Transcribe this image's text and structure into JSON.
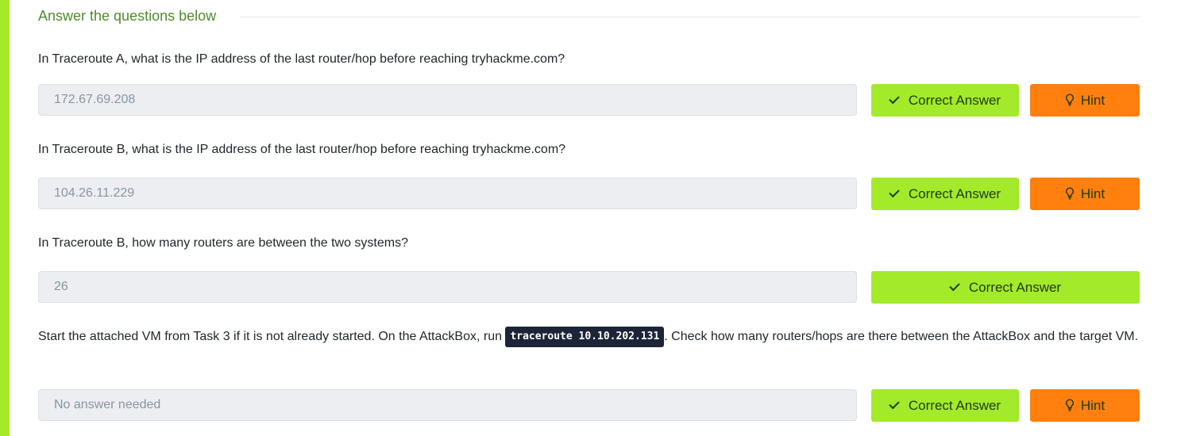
{
  "section": {
    "title": "Answer the questions below"
  },
  "questions": [
    {
      "text": "In Traceroute A, what is the IP address of the last router/hop before reaching tryhackme.com?",
      "answer": "172.67.69.208",
      "correct_label": "Correct Answer",
      "hint_label": "Hint"
    },
    {
      "text": "In Traceroute B, what is the IP address of the last router/hop before reaching tryhackme.com?",
      "answer": "104.26.11.229",
      "correct_label": "Correct Answer",
      "hint_label": "Hint"
    },
    {
      "text": "In Traceroute B, how many routers are between the two systems?",
      "answer": "26",
      "correct_label": "Correct Answer"
    },
    {
      "text_before": "Start the attached VM from Task 3 if it is not already started. On the AttackBox, run ",
      "code": "traceroute 10.10.202.131",
      "text_after": ". Check how many routers/hops are there between the AttackBox and the target VM.",
      "answer": "No answer needed",
      "correct_label": "Correct Answer",
      "hint_label": "Hint"
    }
  ],
  "colors": {
    "accent": "#a3ea2a",
    "hint": "#ff7f0f",
    "title": "#4f8a2e",
    "code_bg": "#1c2538"
  },
  "icons": {
    "correct": "check-icon",
    "hint": "lightbulb-icon"
  }
}
